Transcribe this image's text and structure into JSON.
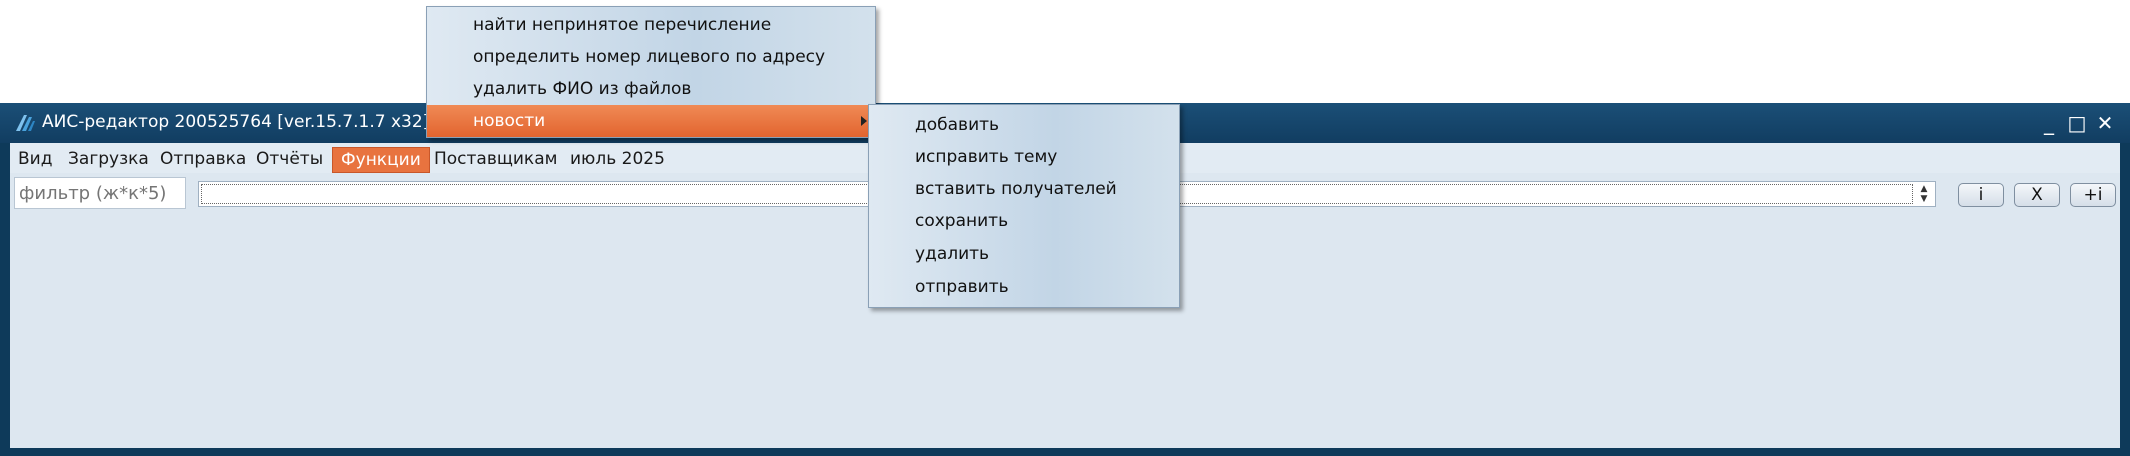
{
  "window": {
    "title": "АИС-редактор 200525764 [ver.15.7.1.7 x32] - Сер",
    "minimize": "_",
    "maximize": "□",
    "close": "✕"
  },
  "menubar": [
    {
      "label": "Вид"
    },
    {
      "label": "Загрузка"
    },
    {
      "label": "Отправка"
    },
    {
      "label": "Отчёты"
    },
    {
      "label": "Функции"
    },
    {
      "label": "Поставщикам"
    },
    {
      "label": "июль 2025"
    }
  ],
  "toolbar": {
    "filter_placeholder": "фильтр (ж*к*5)",
    "info_label": "i",
    "clear_label": "X",
    "add_info_label": "+i"
  },
  "functions_menu": {
    "items": [
      {
        "label": "найти непринятое перечисление"
      },
      {
        "label": "определить номер лицевого по адресу"
      },
      {
        "label": "удалить ФИО из файлов"
      },
      {
        "label": "новости"
      }
    ]
  },
  "news_submenu": {
    "items": [
      {
        "label": "добавить"
      },
      {
        "label": "исправить тему"
      },
      {
        "label": "вставить получателей"
      },
      {
        "label": "сохранить"
      },
      {
        "label": "удалить"
      },
      {
        "label": "отправить"
      }
    ]
  },
  "colors": {
    "titlebar": "#113d61",
    "client_bg": "#dde7f0",
    "menu_highlight": "#e8733f"
  }
}
